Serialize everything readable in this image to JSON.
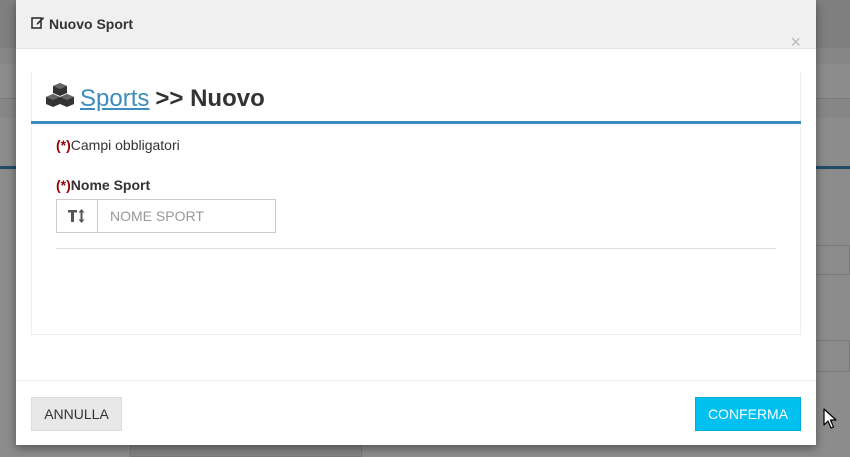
{
  "modal": {
    "header_title": "Nuovo Sport",
    "close_symbol": "×",
    "title": {
      "link": "Sports",
      "suffix": ">> Nuovo"
    },
    "required_mark": "(*)",
    "legend_text": "Campi obbligatori",
    "field": {
      "label": "Nome Sport",
      "placeholder": "NOME SPORT",
      "value": ""
    },
    "footer": {
      "cancel_label": "ANNULLA",
      "confirm_label": "CONFERMA"
    }
  },
  "icons": {
    "header_icon": "edit-icon",
    "title_icon": "cubes-icon",
    "field_icon": "text-height-icon",
    "pointer": "mouse-cursor-icon"
  },
  "colors": {
    "link": "#3c8dbc",
    "required": "#9b0000",
    "confirm_button": "#00c0ef"
  }
}
